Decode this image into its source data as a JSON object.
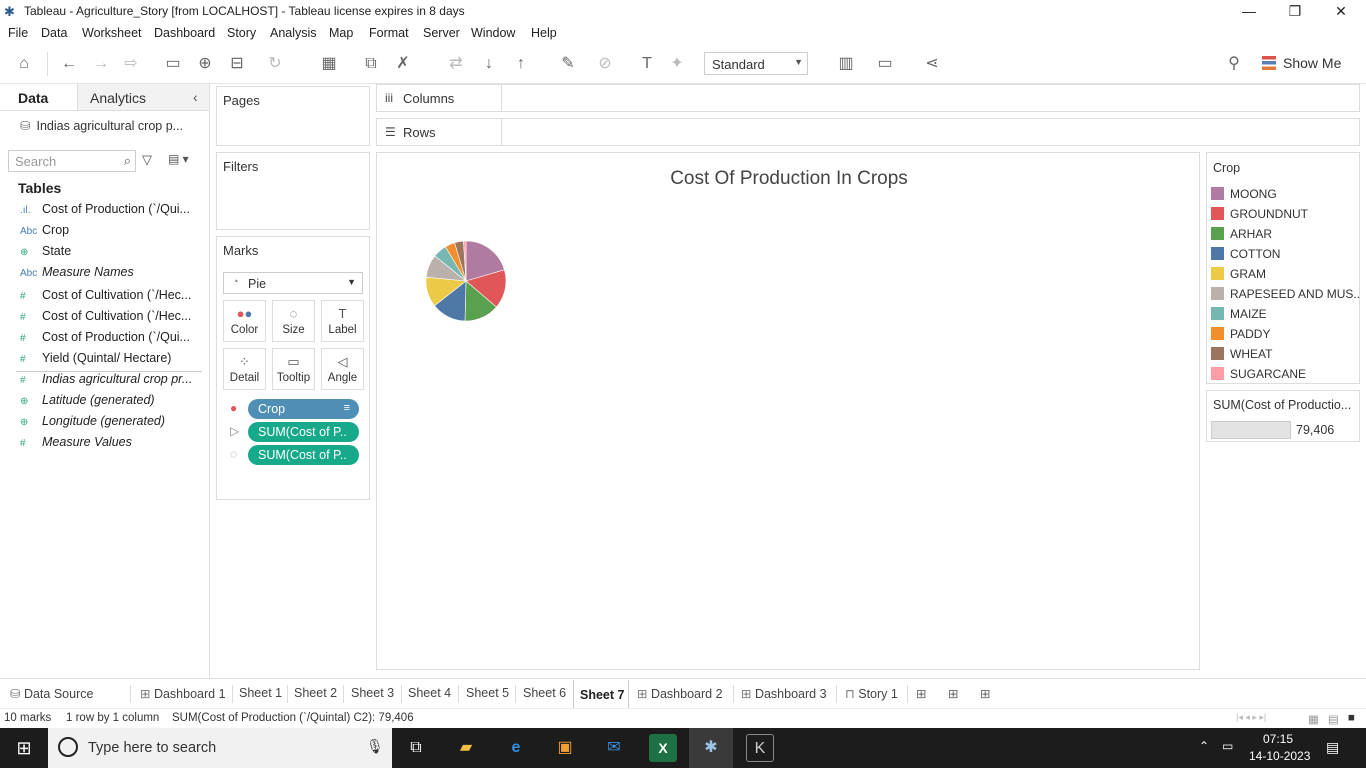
{
  "window": {
    "title": "Tableau - Agriculture_Story [from LOCALHOST] - Tableau license expires in 8 days",
    "minimize": "—",
    "restore": "❐",
    "close": "✕"
  },
  "menu": [
    "File",
    "Data",
    "Worksheet",
    "Dashboard",
    "Story",
    "Analysis",
    "Map",
    "Format",
    "Server",
    "Window",
    "Help"
  ],
  "toolbar": {
    "fit_value": "Standard",
    "show_me_label": "Show Me"
  },
  "data_pane": {
    "tab_data": "Data",
    "tab_analytics": "Analytics",
    "datasource": "Indias agricultural crop p...",
    "search_placeholder": "Search",
    "tables_header": "Tables",
    "fields": [
      {
        "icon": ".ıl.",
        "label": "Cost of Production (`/Qui..."
      },
      {
        "icon": "Abc",
        "label": "Crop"
      },
      {
        "icon": "⊕",
        "label": "State"
      },
      {
        "icon": "Abc",
        "label": "Measure Names"
      },
      {
        "icon": "#",
        "label": "Cost of Cultivation (`/Hec..."
      },
      {
        "icon": "#",
        "label": "Cost of Cultivation (`/Hec..."
      },
      {
        "icon": "#",
        "label": "Cost of Production (`/Qui..."
      },
      {
        "icon": "#",
        "label": "Yield (Quintal/ Hectare)"
      },
      {
        "icon": "#",
        "label": "Indias agricultural crop pr..."
      },
      {
        "icon": "⊕",
        "label": "Latitude (generated)"
      },
      {
        "icon": "⊕",
        "label": "Longitude (generated)"
      },
      {
        "icon": "#",
        "label": "Measure Values"
      }
    ]
  },
  "cards": {
    "pages": "Pages",
    "filters": "Filters",
    "marks": "Marks",
    "mark_type": "Pie",
    "mark_buttons": {
      "color": "Color",
      "size": "Size",
      "label": "Label",
      "detail": "Detail",
      "tooltip": "Tooltip",
      "angle": "Angle"
    },
    "pills": {
      "crop": "Crop",
      "angle": "SUM(Cost of P..",
      "size": "SUM(Cost of P.."
    }
  },
  "shelves": {
    "columns": "Columns",
    "rows": "Rows"
  },
  "chart_data": {
    "type": "pie",
    "title": "Cost Of Production In Crops",
    "categories": [
      "MOONG",
      "GROUNDNUT",
      "ARHAR",
      "COTTON",
      "GRAM",
      "RAPESEED AND MUS..",
      "MAIZE",
      "PADDY",
      "WHEAT",
      "SUGARCANE"
    ],
    "values": [
      20.5,
      15.8,
      14.1,
      14.0,
      12.1,
      9.3,
      5.6,
      4.0,
      3.6,
      1.0
    ],
    "colors": [
      "#b07aa1",
      "#e15759",
      "#59a14f",
      "#4e79a7",
      "#edc948",
      "#bab0ac",
      "#76b7b2",
      "#f28e2b",
      "#9c755f",
      "#ff9da7"
    ],
    "total_label": "79,406"
  },
  "legend": {
    "title": "Crop",
    "size_title": "SUM(Cost of Productio...",
    "size_value": "79,406"
  },
  "sheet_tabs": [
    "Data Source",
    "Dashboard 1",
    "Sheet 1",
    "Sheet 2",
    "Sheet 3",
    "Sheet 4",
    "Sheet 5",
    "Sheet 6",
    "Sheet 7",
    "Dashboard 2",
    "Dashboard 3",
    "Story 1"
  ],
  "status": {
    "marks": "10 marks",
    "dims": "1 row by 1 column",
    "sum": "SUM(Cost of Production (`/Quintal) C2): 79,406"
  },
  "taskbar": {
    "search_placeholder": "Type here to search",
    "time": "07:15",
    "date": "14-10-2023"
  }
}
